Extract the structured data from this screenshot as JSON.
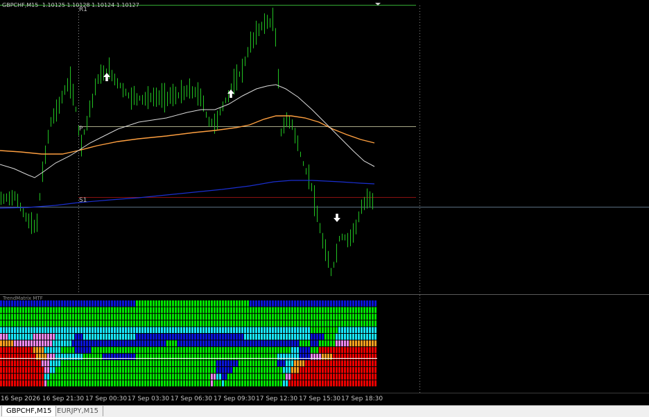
{
  "title": {
    "symbol": "GBPCHF,M15",
    "prices": "1.10125 1.10128 1.10124 1.10127"
  },
  "levels": {
    "r1": "R1",
    "pivot": "P",
    "s1": "S1"
  },
  "indicator": {
    "name": "TrendMatrix MTF"
  },
  "time_axis": {
    "labels": [
      "16 Sep 2026",
      "16 Sep 21:30",
      "17 Sep 00:30",
      "17 Sep 03:30",
      "17 Sep 06:30",
      "17 Sep 09:30",
      "17 Sep 12:30",
      "17 Sep 15:30",
      "17 Sep 18:30"
    ]
  },
  "tabs": [
    {
      "label": "GBPCHF,M15",
      "active": true
    },
    {
      "label": "EURJPY,M15",
      "active": false
    }
  ],
  "colors": {
    "candle": "#22c322",
    "ma_fast": "#dcdcdc",
    "ma_mid": "#ffa040",
    "ma_slow": "#1a2fd0",
    "signal_arrow": "#ffffff",
    "matrix_green": "#00e600",
    "matrix_blue": "#0a14d8",
    "matrix_cyan": "#18e8ff",
    "matrix_red": "#ee0000",
    "matrix_orange": "#ffa020",
    "matrix_pink": "#ee88ee"
  },
  "icons": {
    "up_arrow": "up-arrow-icon",
    "down_arrow": "down-arrow-icon",
    "dropdown": "triangle-down-icon"
  }
}
